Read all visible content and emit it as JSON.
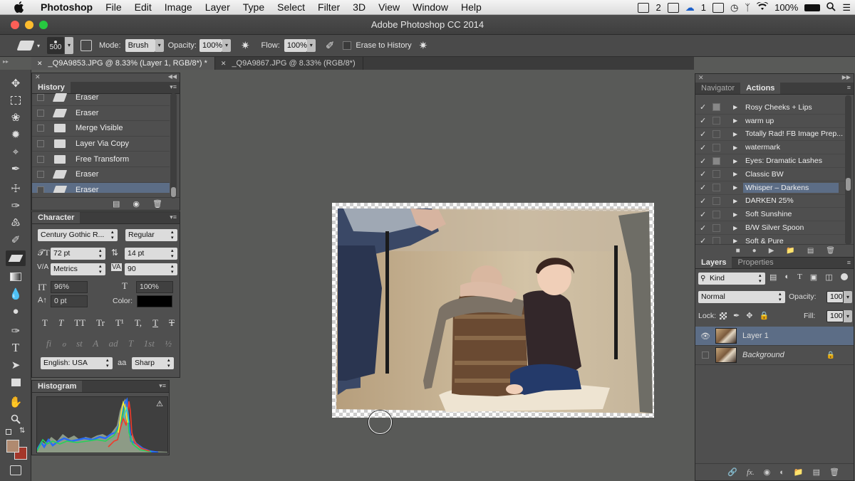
{
  "menubar": {
    "app": "Photoshop",
    "items": [
      "File",
      "Edit",
      "Image",
      "Layer",
      "Type",
      "Select",
      "Filter",
      "3D",
      "View",
      "Window",
      "Help"
    ],
    "status_count_a": "2",
    "status_count_b": "1",
    "battery": "100%"
  },
  "window": {
    "title": "Adobe Photoshop CC 2014"
  },
  "options": {
    "brush_size": "500",
    "mode_label": "Mode:",
    "mode_value": "Brush",
    "opacity_label": "Opacity:",
    "opacity_value": "100%",
    "flow_label": "Flow:",
    "flow_value": "100%",
    "erase_history_label": "Erase to History"
  },
  "tabs": [
    {
      "label": "_Q9A9853.JPG @ 8.33% (Layer 1, RGB/8*) *",
      "active": true
    },
    {
      "label": "_Q9A9867.JPG @ 8.33% (RGB/8*)",
      "active": false
    }
  ],
  "history": {
    "title": "History",
    "items": [
      "Eraser",
      "Eraser",
      "Merge Visible",
      "Layer Via Copy",
      "Free Transform",
      "Eraser",
      "Eraser"
    ],
    "selected_index": 6
  },
  "character": {
    "title": "Character",
    "font_family": "Century Gothic R...",
    "font_style": "Regular",
    "font_size": "72 pt",
    "leading": "14 pt",
    "kerning": "Metrics",
    "tracking": "90",
    "vertical_scale": "96%",
    "horizontal_scale": "100%",
    "baseline_shift": "0 pt",
    "color_label": "Color:",
    "language": "English: USA",
    "aa_label": "aa",
    "antialias": "Sharp",
    "style_buttons": [
      "T",
      "T",
      "TT",
      "Tr",
      "T¹",
      "T,",
      "T",
      "T"
    ],
    "opentype_buttons": [
      "fi",
      "ℴ",
      "st",
      "A",
      "ad",
      "T",
      "1st",
      "½"
    ]
  },
  "histogram": {
    "title": "Histogram"
  },
  "right_top": {
    "tabs": [
      "Navigator",
      "Actions"
    ],
    "active_tab": "Actions",
    "actions": [
      {
        "name": "Rosy Cheeks + Lips",
        "dialog": true
      },
      {
        "name": "warm up",
        "dialog": false
      },
      {
        "name": "Totally Rad! FB Image Prep...",
        "dialog": false
      },
      {
        "name": "watermark",
        "dialog": false
      },
      {
        "name": "Eyes: Dramatic Lashes",
        "dialog": true
      },
      {
        "name": "Classic BW",
        "dialog": false
      },
      {
        "name": "Whisper – Darkens",
        "dialog": false
      },
      {
        "name": "DARKEN 25%",
        "dialog": false
      },
      {
        "name": "Soft Sunshine",
        "dialog": false
      },
      {
        "name": "B/W Silver Spoon",
        "dialog": false
      },
      {
        "name": "Soft & Pure",
        "dialog": false
      }
    ],
    "selected_action_index": 6
  },
  "layers": {
    "tabs": [
      "Layers",
      "Properties"
    ],
    "active_tab": "Layers",
    "filter_kind": "Kind",
    "blend_mode": "Normal",
    "opacity_label": "Opacity:",
    "opacity_value": "100%",
    "lock_label": "Lock:",
    "fill_label": "Fill:",
    "fill_value": "100%",
    "items": [
      {
        "name": "Layer 1",
        "visible": true,
        "selected": true,
        "italic": false,
        "locked": false
      },
      {
        "name": "Background",
        "visible": false,
        "selected": false,
        "italic": true,
        "locked": true
      }
    ]
  },
  "colors": {
    "menubar_bg": "#e8e8e8",
    "workspace": "#595a58",
    "panel": "#4f4f4f",
    "selection": "#5c6d86",
    "foreground_swatch": "#b08a70",
    "background_swatch": "#a4372a"
  },
  "icons": {
    "tools": [
      "move-tool-icon",
      "marquee-tool-icon",
      "lasso-tool-icon",
      "magic-wand-icon",
      "crop-tool-icon",
      "eyedropper-icon",
      "healing-brush-icon",
      "brush-tool-icon",
      "clone-stamp-icon",
      "history-brush-icon",
      "eraser-tool-icon",
      "gradient-tool-icon",
      "blur-tool-icon",
      "dodge-tool-icon",
      "pen-tool-icon",
      "type-tool-icon",
      "path-select-icon",
      "shape-tool-icon",
      "hand-tool-icon",
      "zoom-tool-icon"
    ]
  }
}
